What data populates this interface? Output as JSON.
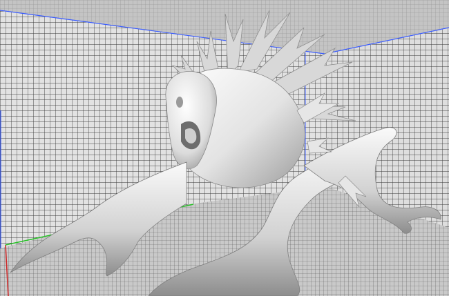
{
  "viewport": {
    "kind": "3d-model-viewport",
    "model": "creature-sculpt",
    "shading": "smooth-gray",
    "walls": "grid",
    "floor": "grid"
  },
  "axes": {
    "x": {
      "name": "x-axis",
      "color": "#cc2a2a"
    },
    "y": {
      "name": "y-axis",
      "color": "#27c027"
    },
    "z": {
      "name": "z-axis",
      "color": "#3a5cff"
    }
  },
  "colors": {
    "background": "#cfcfcf",
    "grid_lines": "#3a3a3a",
    "model_light": "#f2f2f2",
    "model_shadow": "#8a8a8a"
  }
}
